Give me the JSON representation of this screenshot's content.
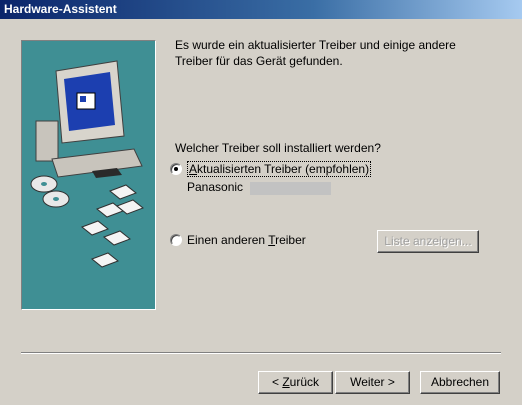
{
  "window": {
    "title": "Hardware-Assistent"
  },
  "intro": {
    "text": "Es wurde ein aktualisierter Treiber und einige andere Treiber für das Gerät gefunden."
  },
  "question": {
    "text": "Welcher Treiber soll installiert werden?"
  },
  "options": [
    {
      "mnemonic": "A",
      "rest": "ktualisierten Treiber (empfohlen)",
      "selected": true
    },
    {
      "before": "Einen anderen ",
      "mnemonic": "T",
      "rest": "reiber",
      "selected": false
    }
  ],
  "driver": {
    "vendor": "Panasonic"
  },
  "buttons": {
    "liste": "Liste anzeigen...",
    "back_prefix": "< ",
    "back_mnemonic": "Z",
    "back_rest": "urück",
    "next": "Weiter >",
    "cancel": "Abbrechen"
  },
  "colors": {
    "title_bar": "#0a246a",
    "illustration_bg": "#3f8f94",
    "dialog_bg": "#d4d0c8"
  }
}
